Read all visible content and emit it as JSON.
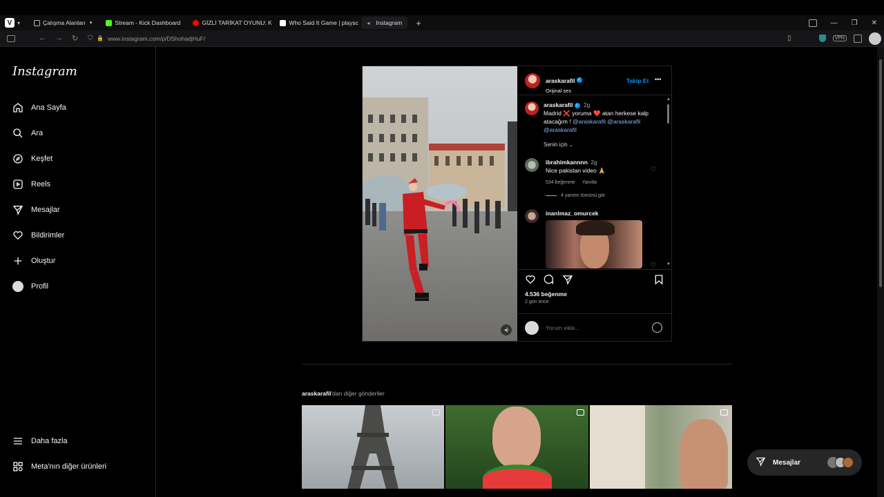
{
  "browser": {
    "workspaces_label": "Çalışma Alanları",
    "tabs": [
      {
        "label": "Stream - Kick Dashboard",
        "color": "#53fc18"
      },
      {
        "label": "GİZLİ TARİKAT OYUNU: KA",
        "color": "#ff0000"
      },
      {
        "label": "Who Said It Game | playsc",
        "color": "#ffffff"
      },
      {
        "label": "Instagram",
        "color": "#888888"
      }
    ],
    "new_tab": "+",
    "url": "www.instagram.com/p/DShohadjHuF/",
    "vpn_label": "VPN"
  },
  "sidebar": {
    "logo": "Instagram",
    "items": [
      {
        "label": "Ana Sayfa",
        "icon": "home-icon"
      },
      {
        "label": "Ara",
        "icon": "search-icon"
      },
      {
        "label": "Keşfet",
        "icon": "compass-icon"
      },
      {
        "label": "Reels",
        "icon": "reels-icon"
      },
      {
        "label": "Mesajlar",
        "icon": "messenger-icon"
      },
      {
        "label": "Bildirimler",
        "icon": "heart-icon"
      },
      {
        "label": "Oluştur",
        "icon": "plus-icon"
      },
      {
        "label": "Profil",
        "icon": "profile-avatar"
      }
    ],
    "more": "Daha fazla",
    "meta": "Meta'nın diğer ürünleri"
  },
  "post": {
    "author": "araskarafil",
    "audio": "Orijinal ses",
    "follow": "Takip Et",
    "menu": "•••",
    "caption_author": "araskarafil",
    "caption_time": "2g",
    "caption_text": "Madrid ❌ yoruma ❤️ atan herkese kalp atacağım !",
    "mentions": [
      "@araskarafil",
      "@araskarafil",
      "@araskarafil"
    ],
    "sort_label": "Senin için",
    "comments": [
      {
        "user": "ibrahimkannnn",
        "time": "2g",
        "text": "Nice pakistan video 🙏",
        "likes": "534 beğenme",
        "reply": "Yanıtla",
        "view_replies": "4 yanıtın tümünü gör"
      },
      {
        "user": "inanlmaz_omurcek",
        "text": ""
      }
    ],
    "likes": "4.536 beğenme",
    "time_ago": "2 gün önce",
    "add_comment_placeholder": "Yorum ekle..."
  },
  "more_posts": {
    "author": "araskarafil",
    "suffix": "'dan diğer gönderiler"
  },
  "messages_bar": {
    "label": "Mesajlar"
  }
}
